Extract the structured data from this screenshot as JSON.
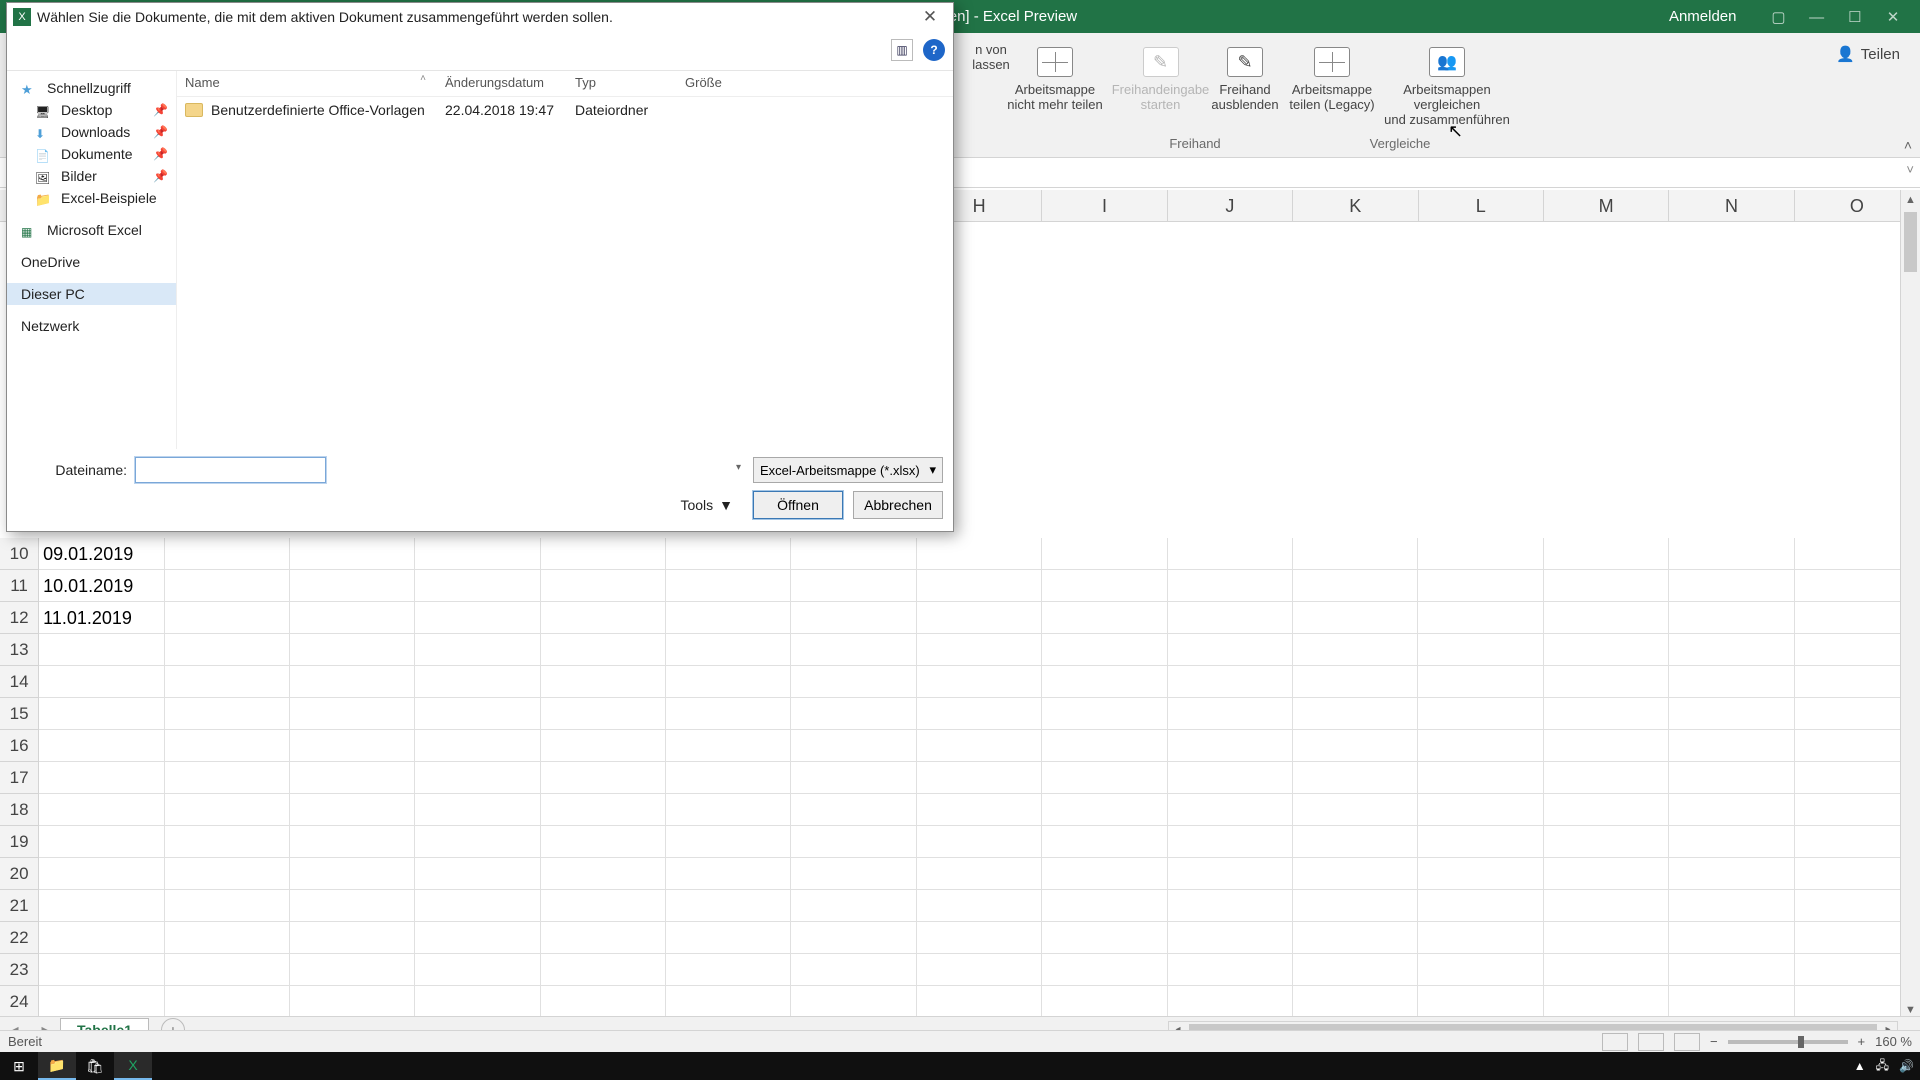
{
  "excel": {
    "title_suffix": ".xlsx  [Freigegeben]  -  Excel Preview",
    "signin": "Anmelden",
    "share": "Teilen"
  },
  "ribbon": {
    "groups": {
      "protect_von": {
        "line1": "n von",
        "line2": "lassen"
      },
      "unshare": {
        "line1": "Arbeitsmappe",
        "line2": "nicht mehr teilen"
      },
      "ink_start": {
        "line1": "Freihandeingabe",
        "line2": "starten"
      },
      "ink_hide": {
        "line1": "Freihand",
        "line2": "ausblenden"
      },
      "share_legacy": {
        "line1": "Arbeitsmappe",
        "line2": "teilen (Legacy)"
      },
      "compare": {
        "line1": "Arbeitsmappen vergleichen",
        "line2": "und zusammenführen"
      }
    },
    "section_ink": "Freihand",
    "section_compare": "Vergleiche"
  },
  "sheet": {
    "columns": [
      "H",
      "I",
      "J",
      "K",
      "L",
      "M",
      "N"
    ],
    "rows": [
      {
        "n": "10",
        "a": "09.01.2019"
      },
      {
        "n": "11",
        "a": "10.01.2019"
      },
      {
        "n": "12",
        "a": "11.01.2019"
      },
      {
        "n": "13",
        "a": ""
      },
      {
        "n": "14",
        "a": ""
      },
      {
        "n": "15",
        "a": ""
      },
      {
        "n": "16",
        "a": ""
      },
      {
        "n": "17",
        "a": ""
      },
      {
        "n": "18",
        "a": ""
      },
      {
        "n": "19",
        "a": ""
      },
      {
        "n": "20",
        "a": ""
      },
      {
        "n": "21",
        "a": ""
      },
      {
        "n": "22",
        "a": ""
      },
      {
        "n": "23",
        "a": ""
      },
      {
        "n": "24",
        "a": ""
      }
    ],
    "tab": "Tabelle1"
  },
  "statusbar": {
    "ready": "Bereit",
    "zoom": "160 %"
  },
  "dialog": {
    "title": "Wählen Sie die Dokumente, die mit dem aktiven Dokument zusammengeführt werden sollen.",
    "nav": {
      "quick": "Schnellzugriff",
      "desktop": "Desktop",
      "downloads": "Downloads",
      "documents": "Dokumente",
      "pictures": "Bilder",
      "examples": "Excel-Beispiele",
      "msexcel": "Microsoft Excel",
      "onedrive": "OneDrive",
      "thispc": "Dieser PC",
      "network": "Netzwerk"
    },
    "cols": {
      "name": "Name",
      "date": "Änderungsdatum",
      "type": "Typ",
      "size": "Größe"
    },
    "files": [
      {
        "name": "Benutzerdefinierte Office-Vorlagen",
        "date": "22.04.2018 19:47",
        "type": "Dateiordner",
        "size": ""
      }
    ],
    "filename_label": "Dateiname:",
    "filename_value": "",
    "filetype": "Excel-Arbeitsmappe (*.xlsx)",
    "tools": "Tools",
    "open": "Öffnen",
    "cancel": "Abbrechen"
  },
  "taskbar": {
    "tray_up": "▲"
  }
}
